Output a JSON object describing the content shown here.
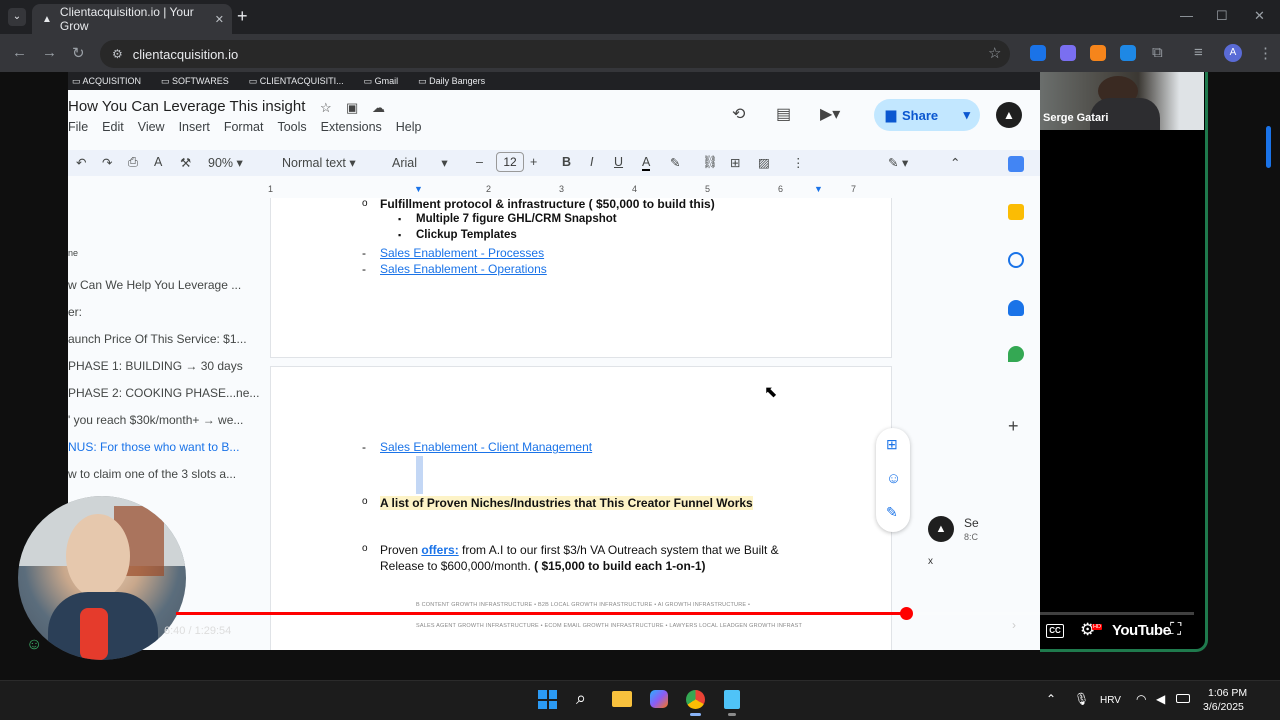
{
  "browser": {
    "tab_title": "Clientacquisition.io | Your Grow",
    "url": "clientacquisition.io",
    "new_tab": "+",
    "window_controls": [
      "—",
      "☐",
      "✕"
    ],
    "profile_initial": "A"
  },
  "doc": {
    "bookmarks": [
      "ACQUISITION",
      "SOFTWARES",
      "CLIENTACQUISITI...",
      "Gmail",
      "Daily Bangers"
    ],
    "title": "How You Can Leverage This insight",
    "menu": [
      "File",
      "Edit",
      "View",
      "Insert",
      "Format",
      "Tools",
      "Extensions",
      "Help"
    ],
    "share_label": "Share",
    "toolbar": {
      "zoom": "90%",
      "style": "Normal text",
      "font": "Arial",
      "size": "12"
    },
    "ruler_ticks": [
      "1",
      "2",
      "3",
      "4",
      "5",
      "6",
      "7"
    ],
    "outline": [
      "ne",
      "w Can We Help You Leverage ...",
      "er:",
      "aunch Price Of This Service: $1...",
      "PHASE 1: BUILDING → 30 days",
      "PHASE 2: COOKING PHASE...ne...",
      "' you reach $30k/month+ → we...",
      "NUS: For those who want to B...",
      "w to claim one of the 3 slots a..."
    ],
    "page1": {
      "item_bullet": "o",
      "item1": "Fulfillment protocol & infrastructure ( $50,000 to build this)",
      "subitems": [
        "Multiple 7 figure GHL/CRM Snapshot",
        "Clickup Templates"
      ],
      "sub_bullet": "▪",
      "dash": "-",
      "links": [
        "Sales Enablement - Processes",
        "Sales Enablement - Operations"
      ]
    },
    "page2": {
      "link": "Sales Enablement - Client Management",
      "niches": "A list of Proven Niches/Industries that This Creator Funnel Works",
      "proven_prefix": "Proven ",
      "proven_link": "offers:",
      "proven_text": " from A.I to our first $3/h VA Outreach system that we Built & Release to $600,000/month. ",
      "proven_bold": "( $15,000 to build each 1-on-1)",
      "tiny_row1": "B CONTENT GROWTH INFRASTRUCTURE   •   B2B LOCAL GROWTH INFRASTRUCTURE   •   AI GROWTH INFRASTRUCTURE   •",
      "tiny_row2": "SALES AGENT GROWTH INFRASTRUCTURE   •   ECOM EMAIL GROWTH INFRASTRUCTURE   •   LAWYERS LOCAL LEADGEN GROWTH INFRAST"
    },
    "notif": {
      "name": "Se",
      "time": "8:C",
      "close": "x"
    }
  },
  "webcam": {
    "name": "Serge Gatari"
  },
  "player": {
    "time": "6:40 / 1:29:54",
    "progress": 0.717,
    "youtube": "YouTube",
    "cc": "CC",
    "hd": "HD"
  },
  "taskbar": {
    "lang": "HRV",
    "time": "1:06 PM",
    "date": "3/6/2025"
  },
  "colors": {
    "accent_red": "#ff0000",
    "share_bg": "#c2e7ff",
    "frame_green": "#1f7a4d",
    "link_blue": "#1a73e8"
  }
}
